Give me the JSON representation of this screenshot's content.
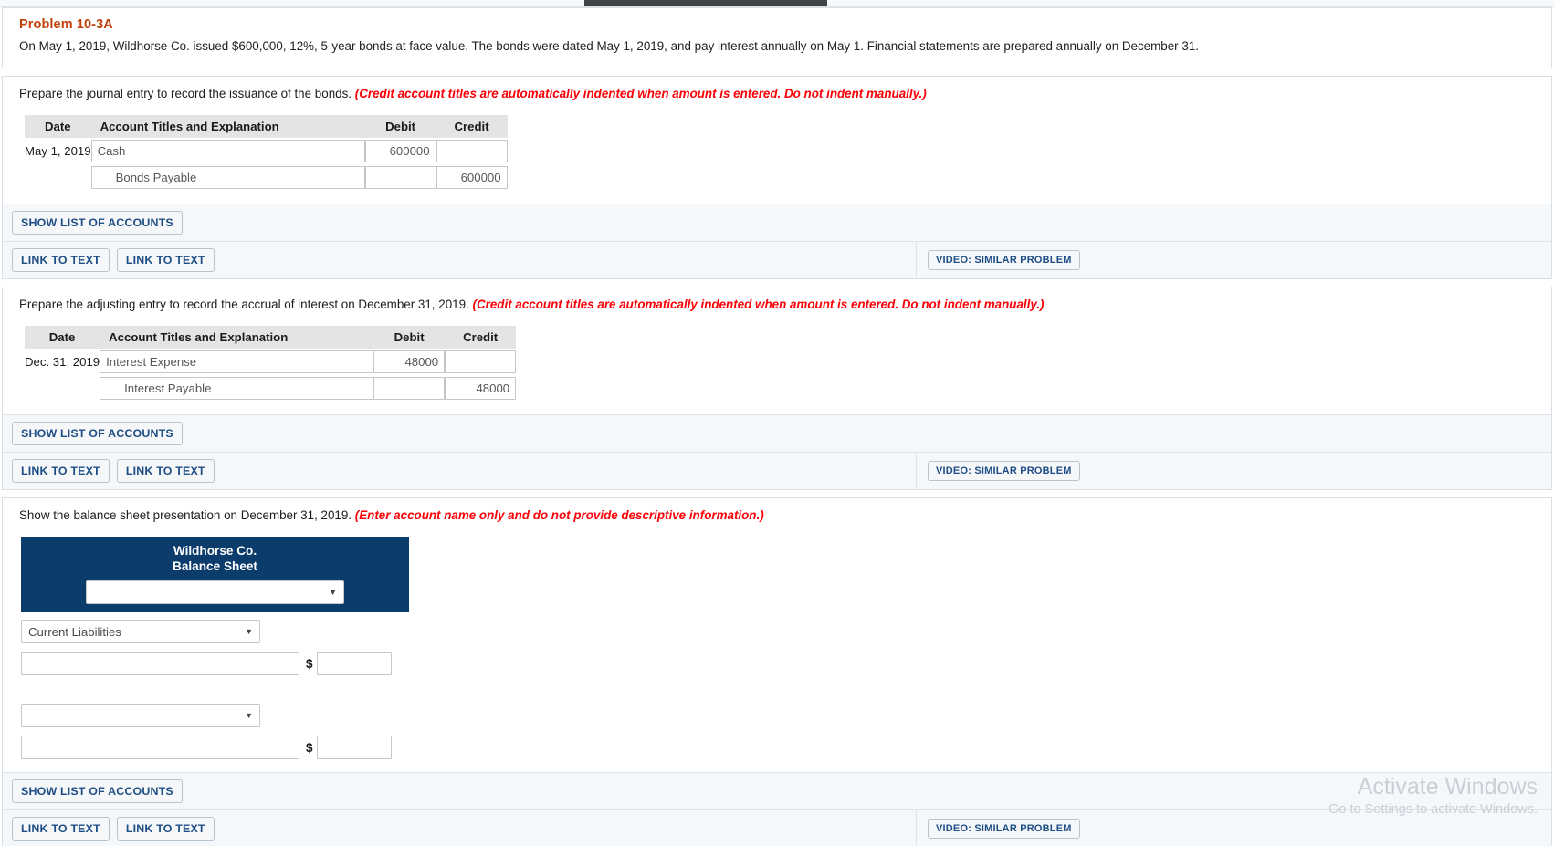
{
  "window": {
    "scrollbar": "horizontal-scroll-thumb"
  },
  "problem": {
    "title": "Problem 10-3A",
    "statement": "On May 1, 2019, Wildhorse Co. issued $600,000, 12%, 5-year bonds at face value. The bonds were dated May 1, 2019, and pay interest annually on May 1. Financial statements are prepared annually on December 31."
  },
  "common": {
    "show_list_label": "SHOW LIST OF ACCOUNTS",
    "link_to_text_label": "LINK TO TEXT",
    "video_label": "VIDEO: SIMILAR PROBLEM",
    "columns": {
      "date": "Date",
      "account": "Account Titles and Explanation",
      "debit": "Debit",
      "credit": "Credit"
    },
    "account_placeholder": "",
    "amount_placeholder": "",
    "accent_blue": "#1e4e86",
    "hint_red": "#fb0007",
    "title_orange": "#c2410c",
    "navy": "#0b3c6b"
  },
  "section1": {
    "prompt": "Prepare the journal entry to record the issuance of the bonds.",
    "hint": "(Credit account titles are automatically indented when amount is entered. Do not indent manually.)",
    "rows": [
      {
        "date": "May 1, 2019",
        "account": "Cash",
        "indent": false,
        "debit": "600000",
        "credit": ""
      },
      {
        "date": "",
        "account": "Bonds Payable",
        "indent": true,
        "debit": "",
        "credit": "600000"
      }
    ]
  },
  "section2": {
    "prompt": "Prepare the adjusting entry to record the accrual of interest on December 31, 2019.",
    "hint": "(Credit account titles are automatically indented when amount is entered. Do not indent manually.)",
    "rows": [
      {
        "date": "Dec. 31, 2019",
        "account": "Interest Expense",
        "indent": false,
        "debit": "48000",
        "credit": ""
      },
      {
        "date": "",
        "account": "Interest Payable",
        "indent": true,
        "debit": "",
        "credit": "48000"
      }
    ]
  },
  "section3": {
    "prompt": "Show the balance sheet presentation on December 31, 2019.",
    "hint": "(Enter account name only and do not provide descriptive information.)",
    "company": "Wildhorse Co.",
    "report": "Balance Sheet",
    "header_select_value": "",
    "category_select_value": "Current Liabilities",
    "second_select_value": "",
    "rows": [
      {
        "account": "",
        "dollar": "$",
        "amount": ""
      },
      {
        "account": "",
        "dollar": "$",
        "amount": ""
      }
    ]
  },
  "watermark": {
    "line1": "Activate Windows",
    "line2": "Go to Settings to activate Windows."
  }
}
